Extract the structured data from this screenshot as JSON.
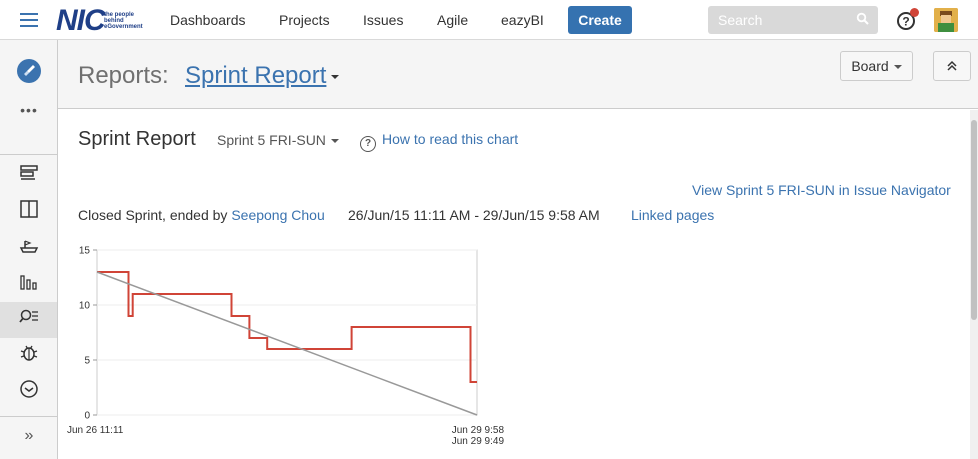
{
  "topnav": {
    "logo_text": "NIC",
    "logo_tagline": "the people behind eGovernment",
    "items": [
      "Dashboards",
      "Projects",
      "Issues",
      "Agile",
      "eazyBI"
    ],
    "create_label": "Create",
    "search_placeholder": "Search"
  },
  "sidebar": {
    "icons": [
      "rocket-icon",
      "more-icon",
      "backlog-icon",
      "board-icon",
      "releases-icon",
      "reports-icon",
      "issue-search-icon",
      "bug-icon",
      "clock-icon",
      "expand-icon"
    ]
  },
  "header": {
    "reports_label": "Reports:",
    "report_name": "Sprint Report",
    "board_label": "Board"
  },
  "content": {
    "title": "Sprint Report",
    "sprint_selector": "Sprint 5 FRI-SUN",
    "howto_link": "How to read this chart",
    "view_link": "View Sprint 5 FRI-SUN in Issue Navigator",
    "closed_prefix": "Closed Sprint, ended by",
    "ended_by": "Seepong Chou",
    "date_range": "26/Jun/15 11:11 AM - 29/Jun/15 9:58 AM",
    "linked_pages": "Linked pages"
  },
  "colors": {
    "accent": "#3b73af",
    "create": "#3572b0",
    "burndown": "#d04437",
    "guideline": "#999999"
  },
  "chart_data": {
    "type": "line",
    "ylim": [
      0,
      15
    ],
    "yticks": [
      0,
      5,
      10,
      15
    ],
    "x_labels": [
      "Jun 26 11:11",
      "Jun 29 9:58",
      "Jun 29 9:49"
    ],
    "series": [
      {
        "role": "remaining",
        "points": [
          [
            0,
            13
          ],
          [
            0.083,
            13
          ],
          [
            0.083,
            9
          ],
          [
            0.094,
            9
          ],
          [
            0.094,
            11
          ],
          [
            0.354,
            11
          ],
          [
            0.354,
            9
          ],
          [
            0.401,
            9
          ],
          [
            0.401,
            7
          ],
          [
            0.448,
            7
          ],
          [
            0.448,
            6
          ],
          [
            0.67,
            6
          ],
          [
            0.67,
            8
          ],
          [
            0.983,
            8
          ],
          [
            0.983,
            3
          ],
          [
            1.0,
            3
          ]
        ]
      },
      {
        "role": "guideline",
        "points": [
          [
            0,
            13
          ],
          [
            1.0,
            0
          ]
        ]
      }
    ]
  }
}
